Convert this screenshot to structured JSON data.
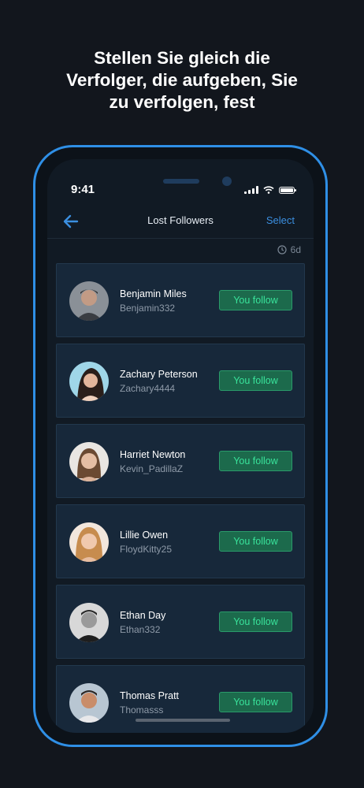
{
  "headline": {
    "line1": "Stellen Sie gleich die",
    "line2": "Verfolger, die aufgeben, Sie",
    "line3": "zu verfolgen, fest"
  },
  "status_bar": {
    "time": "9:41"
  },
  "navbar": {
    "title": "Lost Followers",
    "select_label": "Select"
  },
  "period_label": "6d",
  "colors": {
    "accent": "#2f8fe6",
    "follow_bg": "#1c6a4c",
    "follow_text": "#39e39b",
    "card_bg": "#17283a"
  },
  "followers": [
    {
      "name": "Benjamin Miles",
      "handle": "Benjamin332",
      "button": "You follow"
    },
    {
      "name": "Zachary Peterson",
      "handle": "Zachary4444",
      "button": "You follow"
    },
    {
      "name": "Harriet Newton",
      "handle": "Kevin_PadillaZ",
      "button": "You follow"
    },
    {
      "name": "Lillie Owen",
      "handle": "FloydKitty25",
      "button": "You follow"
    },
    {
      "name": "Ethan Day",
      "handle": "Ethan332",
      "button": "You follow"
    },
    {
      "name": "Thomas Pratt",
      "handle": "Thomasss",
      "button": "You follow"
    }
  ]
}
